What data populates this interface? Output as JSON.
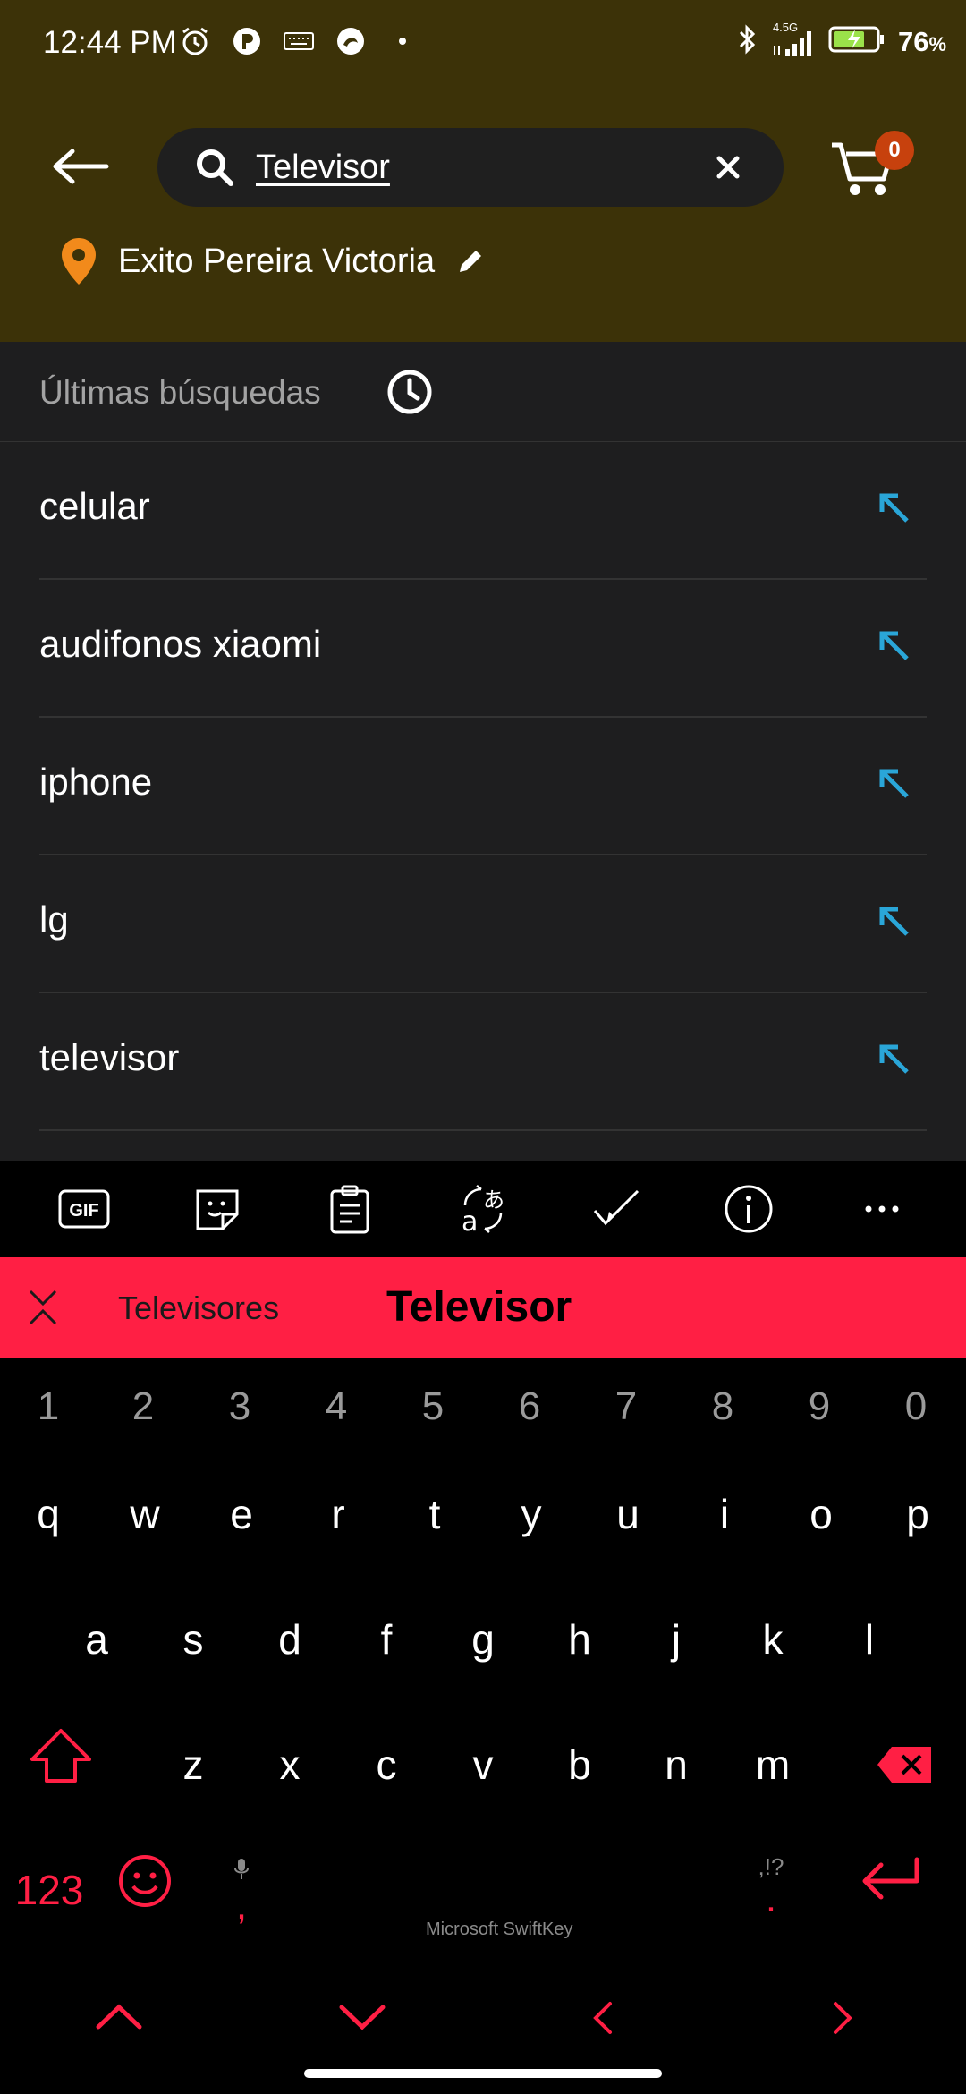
{
  "status_bar": {
    "time": "12:44 PM",
    "network": "4.5G",
    "battery_pct": "76",
    "battery_unit": "%"
  },
  "header": {
    "search_value": "Televisor",
    "cart_count": "0",
    "store_name": "Exito Pereira Victoria"
  },
  "recent": {
    "title": "Últimas búsquedas",
    "items": [
      "celular",
      "audifonos xiaomi",
      "iphone",
      "lg",
      "televisor"
    ]
  },
  "keyboard": {
    "suggestions": [
      "Televisores",
      "Televisor"
    ],
    "numbers": [
      "1",
      "2",
      "3",
      "4",
      "5",
      "6",
      "7",
      "8",
      "9",
      "0"
    ],
    "row1": [
      "q",
      "w",
      "e",
      "r",
      "t",
      "y",
      "u",
      "i",
      "o",
      "p"
    ],
    "row2": [
      "a",
      "s",
      "d",
      "f",
      "g",
      "h",
      "j",
      "k",
      "l"
    ],
    "row3": [
      "z",
      "x",
      "c",
      "v",
      "b",
      "n",
      "m"
    ],
    "mode_key": "123",
    "comma": ",",
    "punct_hint": ",!?",
    "period": ".",
    "brand": "Microsoft SwiftKey",
    "tools": [
      "GIF"
    ]
  },
  "colors": {
    "header_bg": "#3c3208",
    "panel_bg": "#1e1e1f",
    "accent_red": "#ff1f44",
    "arrow_blue": "#2aa6d8",
    "pin_orange": "#f28a1b",
    "badge": "#c7410d"
  }
}
